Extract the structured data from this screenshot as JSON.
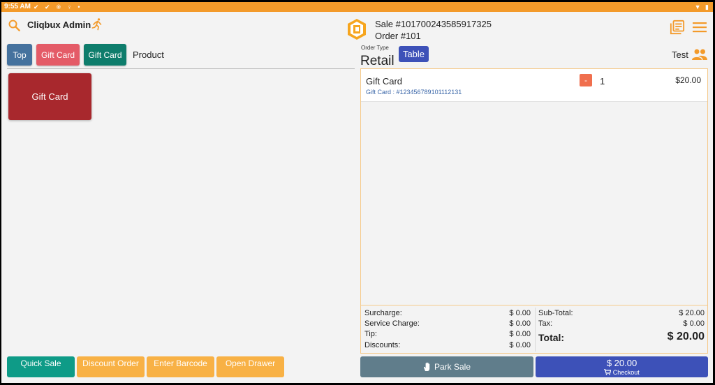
{
  "statusbar": {
    "time": "9:55 AM",
    "status_icons": "✔ ✔ ※ ♀ •",
    "right_icons": "▼ ▮"
  },
  "header": {
    "admin_name": "Cliqbux Admin",
    "sale_number": "Sale #101700243585917325",
    "order_number": "Order #101"
  },
  "categories": {
    "top": "Top",
    "gift1": "Gift Card",
    "gift2": "Gift Card",
    "product": "Product"
  },
  "products": [
    {
      "label": "Gift Card"
    }
  ],
  "bottom_buttons": {
    "quick_sale": "Quick Sale",
    "discount_order": "Discount Order",
    "enter_barcode": "Enter Barcode",
    "open_drawer": "Open Drawer"
  },
  "order": {
    "type_label": "Order Type",
    "type_value": "Retail",
    "table_button": "Table",
    "customer_name": "Test"
  },
  "cart": {
    "items": [
      {
        "name": "Gift Card",
        "sub": "Gift Card : #123456789101112131",
        "minus": "-",
        "qty": "1",
        "price": "$20.00"
      }
    ]
  },
  "totals": {
    "surcharge_label": "Surcharge:",
    "surcharge_value": "$ 0.00",
    "service_label": "Service Charge:",
    "service_value": "$ 0.00",
    "tip_label": "Tip:",
    "tip_value": "$ 0.00",
    "discounts_label": "Discounts:",
    "discounts_value": "$ 0.00",
    "subtotal_label": "Sub-Total:",
    "subtotal_value": "$ 20.00",
    "tax_label": "Tax:",
    "tax_value": "$ 0.00",
    "total_label": "Total:",
    "total_value": "$ 20.00"
  },
  "actions": {
    "park_sale": "Park Sale",
    "checkout_amount": "$ 20.00",
    "checkout_label": "Checkout"
  },
  "colors": {
    "accent": "#f39a2a",
    "primary": "#3d51b8",
    "teal": "#0e7d6c",
    "gift_tile": "#a8282d"
  }
}
